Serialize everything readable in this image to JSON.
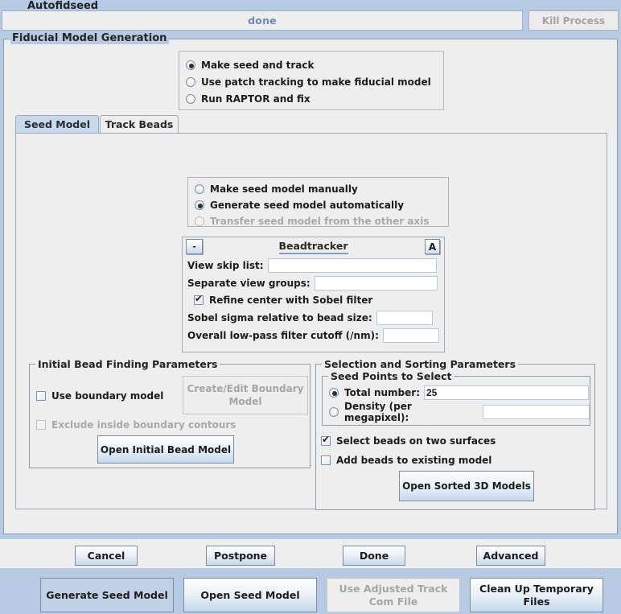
{
  "window": {
    "title": "Autofidseed"
  },
  "progress": {
    "status_text": "done",
    "kill_button_label": "Kill Process"
  },
  "fiducial_group": {
    "legend": "Fiducial Model Generation",
    "mode_options": [
      {
        "label": "Make seed and track",
        "selected": true,
        "disabled": false
      },
      {
        "label": "Use patch tracking to make fiducial model",
        "selected": false,
        "disabled": false
      },
      {
        "label": "Run RAPTOR and fix",
        "selected": false,
        "disabled": false
      }
    ]
  },
  "tabs": [
    {
      "label": "Seed Model",
      "selected": true
    },
    {
      "label": "Track Beads",
      "selected": false
    }
  ],
  "seed_tab": {
    "seed_mode_options": [
      {
        "label": "Make seed model manually",
        "selected": false,
        "disabled": false
      },
      {
        "label": "Generate seed model automatically",
        "selected": true,
        "disabled": false
      },
      {
        "label": "Transfer seed model from the other axis",
        "selected": false,
        "disabled": true
      }
    ],
    "beadtracker": {
      "minus_label": "-",
      "title": "Beadtracker",
      "advanced_label": "A",
      "view_skip_list": {
        "label": "View skip list:",
        "value": ""
      },
      "separate_view_groups": {
        "label": "Separate view groups:",
        "value": ""
      },
      "refine_center": {
        "label": "Refine center with Sobel filter",
        "checked": true
      },
      "sobel_sigma": {
        "label": "Sobel sigma relative to bead size:",
        "value": ""
      },
      "lowpass_cutoff": {
        "label": "Overall low-pass filter cutoff (/nm):",
        "value": ""
      }
    },
    "bead_finding": {
      "legend": "Initial Bead Finding Parameters",
      "use_boundary_model": {
        "label": "Use boundary model",
        "checked": false,
        "disabled": false
      },
      "create_edit_boundary_button": "Create/Edit Boundary Model",
      "exclude_inside": {
        "label": "Exclude inside boundary contours",
        "checked": false,
        "disabled": true
      },
      "open_initial_bead_button": "Open Initial Bead Model"
    },
    "selection_sorting": {
      "legend": "Selection and Sorting Parameters",
      "seed_points_legend": "Seed Points to Select",
      "total_number": {
        "label": "Total number:",
        "selected": true,
        "value": "25"
      },
      "density": {
        "label": "Density (per megapixel):",
        "selected": false,
        "value": ""
      },
      "select_two_surfaces": {
        "label": "Select beads on two surfaces",
        "checked": true
      },
      "add_to_existing": {
        "label": "Add beads to existing model",
        "checked": false
      },
      "open_sorted_button": "Open Sorted 3D Models"
    },
    "actions": [
      {
        "label": "Generate Seed Model",
        "state": "default-focused"
      },
      {
        "label": "Open Seed Model",
        "state": "normal"
      },
      {
        "label": "Use Adjusted Track Com File",
        "state": "disabled"
      },
      {
        "label": "Clean Up Temporary Files",
        "state": "normal"
      }
    ]
  },
  "dialog_buttons": [
    {
      "label": "Cancel"
    },
    {
      "label": "Postpone"
    },
    {
      "label": "Done"
    },
    {
      "label": "Advanced"
    }
  ],
  "colors": {
    "window_background": "#b6cbe3",
    "panel_background": "#eeeeee",
    "accent_blue": "#6c88bd",
    "selected_tab": "#c6d9ef",
    "default_button": "#c1d2e6",
    "disabled_text": "#a5a5a5"
  }
}
